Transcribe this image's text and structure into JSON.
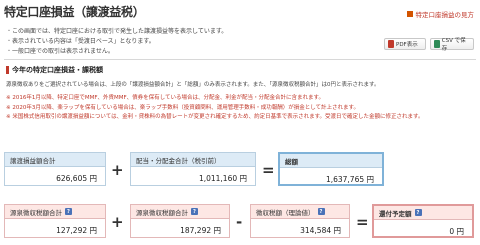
{
  "header": {
    "title": "特定口座損益（譲渡益税）",
    "help_link": "特定口座損益の見方"
  },
  "notes": [
    "この画面では、特定口座における取引で発生した譲渡損益等を表示しています。",
    "表示されている内容は「受渡日ベース」となります。",
    "一般口座での取引は表示されません。"
  ],
  "buttons": {
    "pdf": "PDF表示",
    "csv": "CSV で保存"
  },
  "section": {
    "title": "今年の特定口座損益・課税額",
    "description": "源泉徴収ありをご選択されている場合は、上段の「譲渡損益額合計」と「総額」のみ表示されます。また、「源泉徴収税額合計」は0円と表示されます。",
    "bullets": [
      "※ 2016年1月以降、特定口座でMMF、外貨MMF、債券を保有している場合は、分配金、利金が配当・分配金合計に含まれます。",
      "※ 2020年3月以降、楽ラップを保有している場合は、楽ラップ手数料（投資顧問料、運用管理手数料・成功報酬）が損金として計上されます。",
      "※ 米国株式信用取引の譲渡損益額については、金利・貸株料の為替レートが変更され確定するため、約定日基準で表示されます。受渡日で確定した金額に修正されます。"
    ]
  },
  "row1": {
    "box1": {
      "label": "譲渡損益額合計",
      "value": "626,605 円"
    },
    "op1": "+",
    "box2": {
      "label": "配当・分配金合計（税引前）",
      "value": "1,011,160 円"
    },
    "op2": "=",
    "box3": {
      "label": "総額",
      "value": "1,637,765 円"
    }
  },
  "row2": {
    "box1": {
      "label": "源泉徴収税額合計",
      "value": "127,292 円"
    },
    "op1": "+",
    "box2": {
      "label": "源泉徴収税額合計",
      "value": "187,292 円"
    },
    "op2": "-",
    "box3": {
      "label": "徴収税額（理論値）",
      "value": "314,584 円"
    },
    "op3": "=",
    "box4": {
      "label": "還付予定額",
      "value": "0 円"
    }
  },
  "icons": {
    "help": "question-mark-icon",
    "pdf": "pdf-file-icon",
    "csv": "csv-file-icon"
  },
  "colors": {
    "accent_red": "#c0392b",
    "box_blue": "#ddebf6",
    "box_pink": "#fde7e4"
  }
}
